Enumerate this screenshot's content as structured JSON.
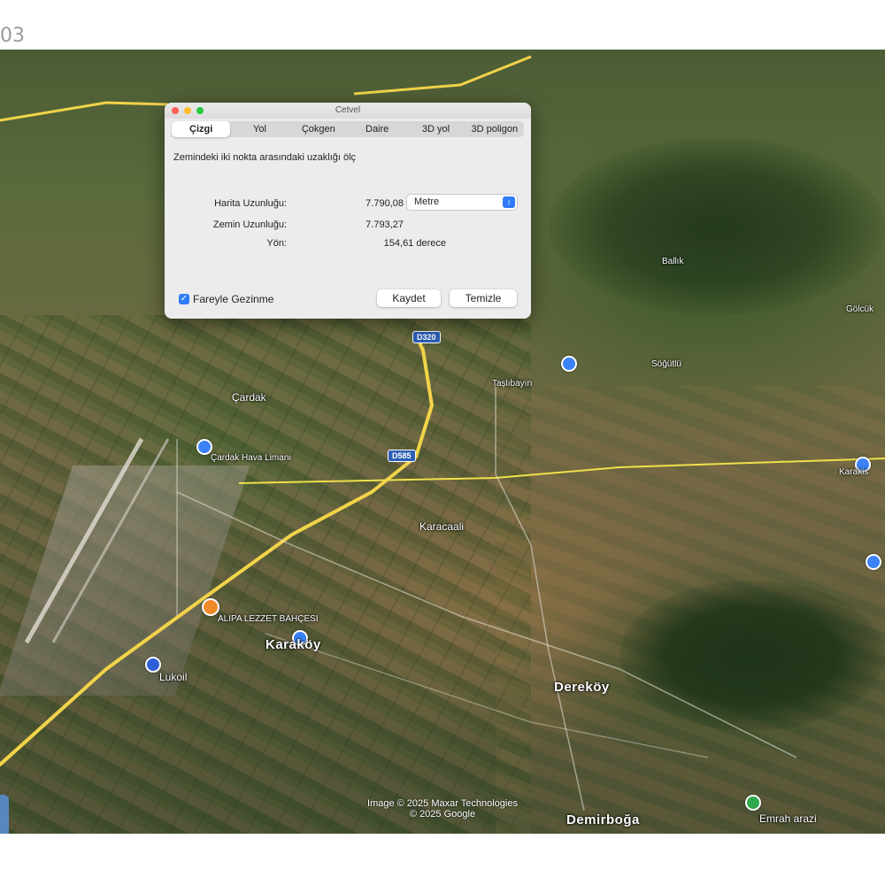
{
  "page": {
    "corner_label": "03"
  },
  "dialog": {
    "title": "Cetvel",
    "tabs": [
      "Çizgi",
      "Yol",
      "Çokgen",
      "Daire",
      "3D yol",
      "3D poligon"
    ],
    "active_tab": 0,
    "description": "Zemindeki iki nokta arasındaki uzaklığı ölç",
    "map_length_label": "Harita Uzunluğu:",
    "map_length_value": "7.790,08",
    "ground_length_label": "Zemin Uzunluğu:",
    "ground_length_value": "7.793,27",
    "direction_label": "Yön:",
    "direction_value": "154,61 derece",
    "unit_select": "Metre",
    "mouse_nav_label": "Fareyle Gezinme",
    "mouse_nav_checked": true,
    "save_label": "Kaydet",
    "clear_label": "Temizle"
  },
  "map": {
    "places": {
      "cardak": "Çardak",
      "airport": "Çardak Hava Limanı",
      "karacaali": "Karacaali",
      "karakoy": "Karaköy",
      "derekoy": "Dereköy",
      "demirboga": "Demirboğa",
      "lukoil": "Lukoil",
      "restaurant": "ALIPA LEZZET BAHÇESI",
      "emrah": "Emrah arazi",
      "karakis": "Karakis",
      "sogutlu": "Söğütlü",
      "top_village": "Taşlıbayırı",
      "right_small": "Ballık",
      "far_small": "Gölcük"
    },
    "route_shields": [
      "D320",
      "D585",
      "D585"
    ],
    "attribution": "Image © 2025 Maxar Technologies\n© 2025 Google"
  },
  "colors": {
    "accent": "#2f7cf6",
    "route_yellow": "#f2d34a",
    "measure_line": "#f0e04a"
  }
}
